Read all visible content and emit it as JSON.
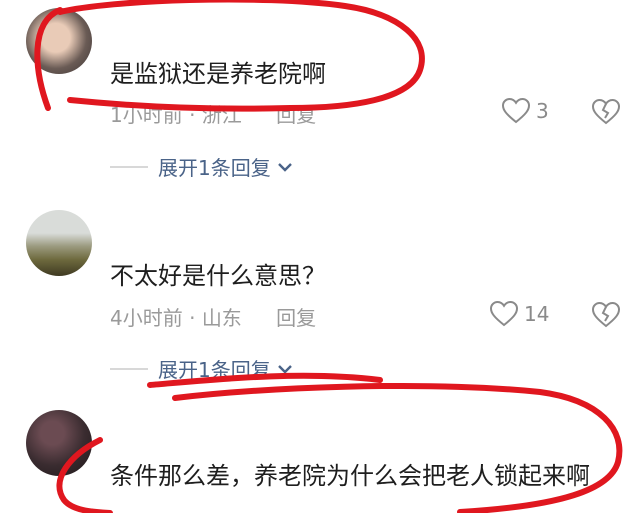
{
  "comments": [
    {
      "username": "",
      "text": "是监狱还是养老院啊",
      "time": "1小时前",
      "location": "浙江",
      "reply_label": "回复",
      "likes": "3",
      "expand_label": "展开1条回复"
    },
    {
      "username": "",
      "text": "不太好是什么意思？",
      "time": "4小时前",
      "location": "山东",
      "reply_label": "回复",
      "likes": "14",
      "expand_label": "展开1条回复"
    },
    {
      "username": "",
      "text": "条件那么差，养老院为什么会把老人锁起来啊"
    }
  ],
  "separator": " · ",
  "colors": {
    "annotation_red": "#e0171f",
    "link_blue": "#4a6388",
    "meta_gray": "#9a9a9a"
  },
  "icons": [
    "heart-outline-icon",
    "broken-heart-icon",
    "chevron-down-icon"
  ]
}
